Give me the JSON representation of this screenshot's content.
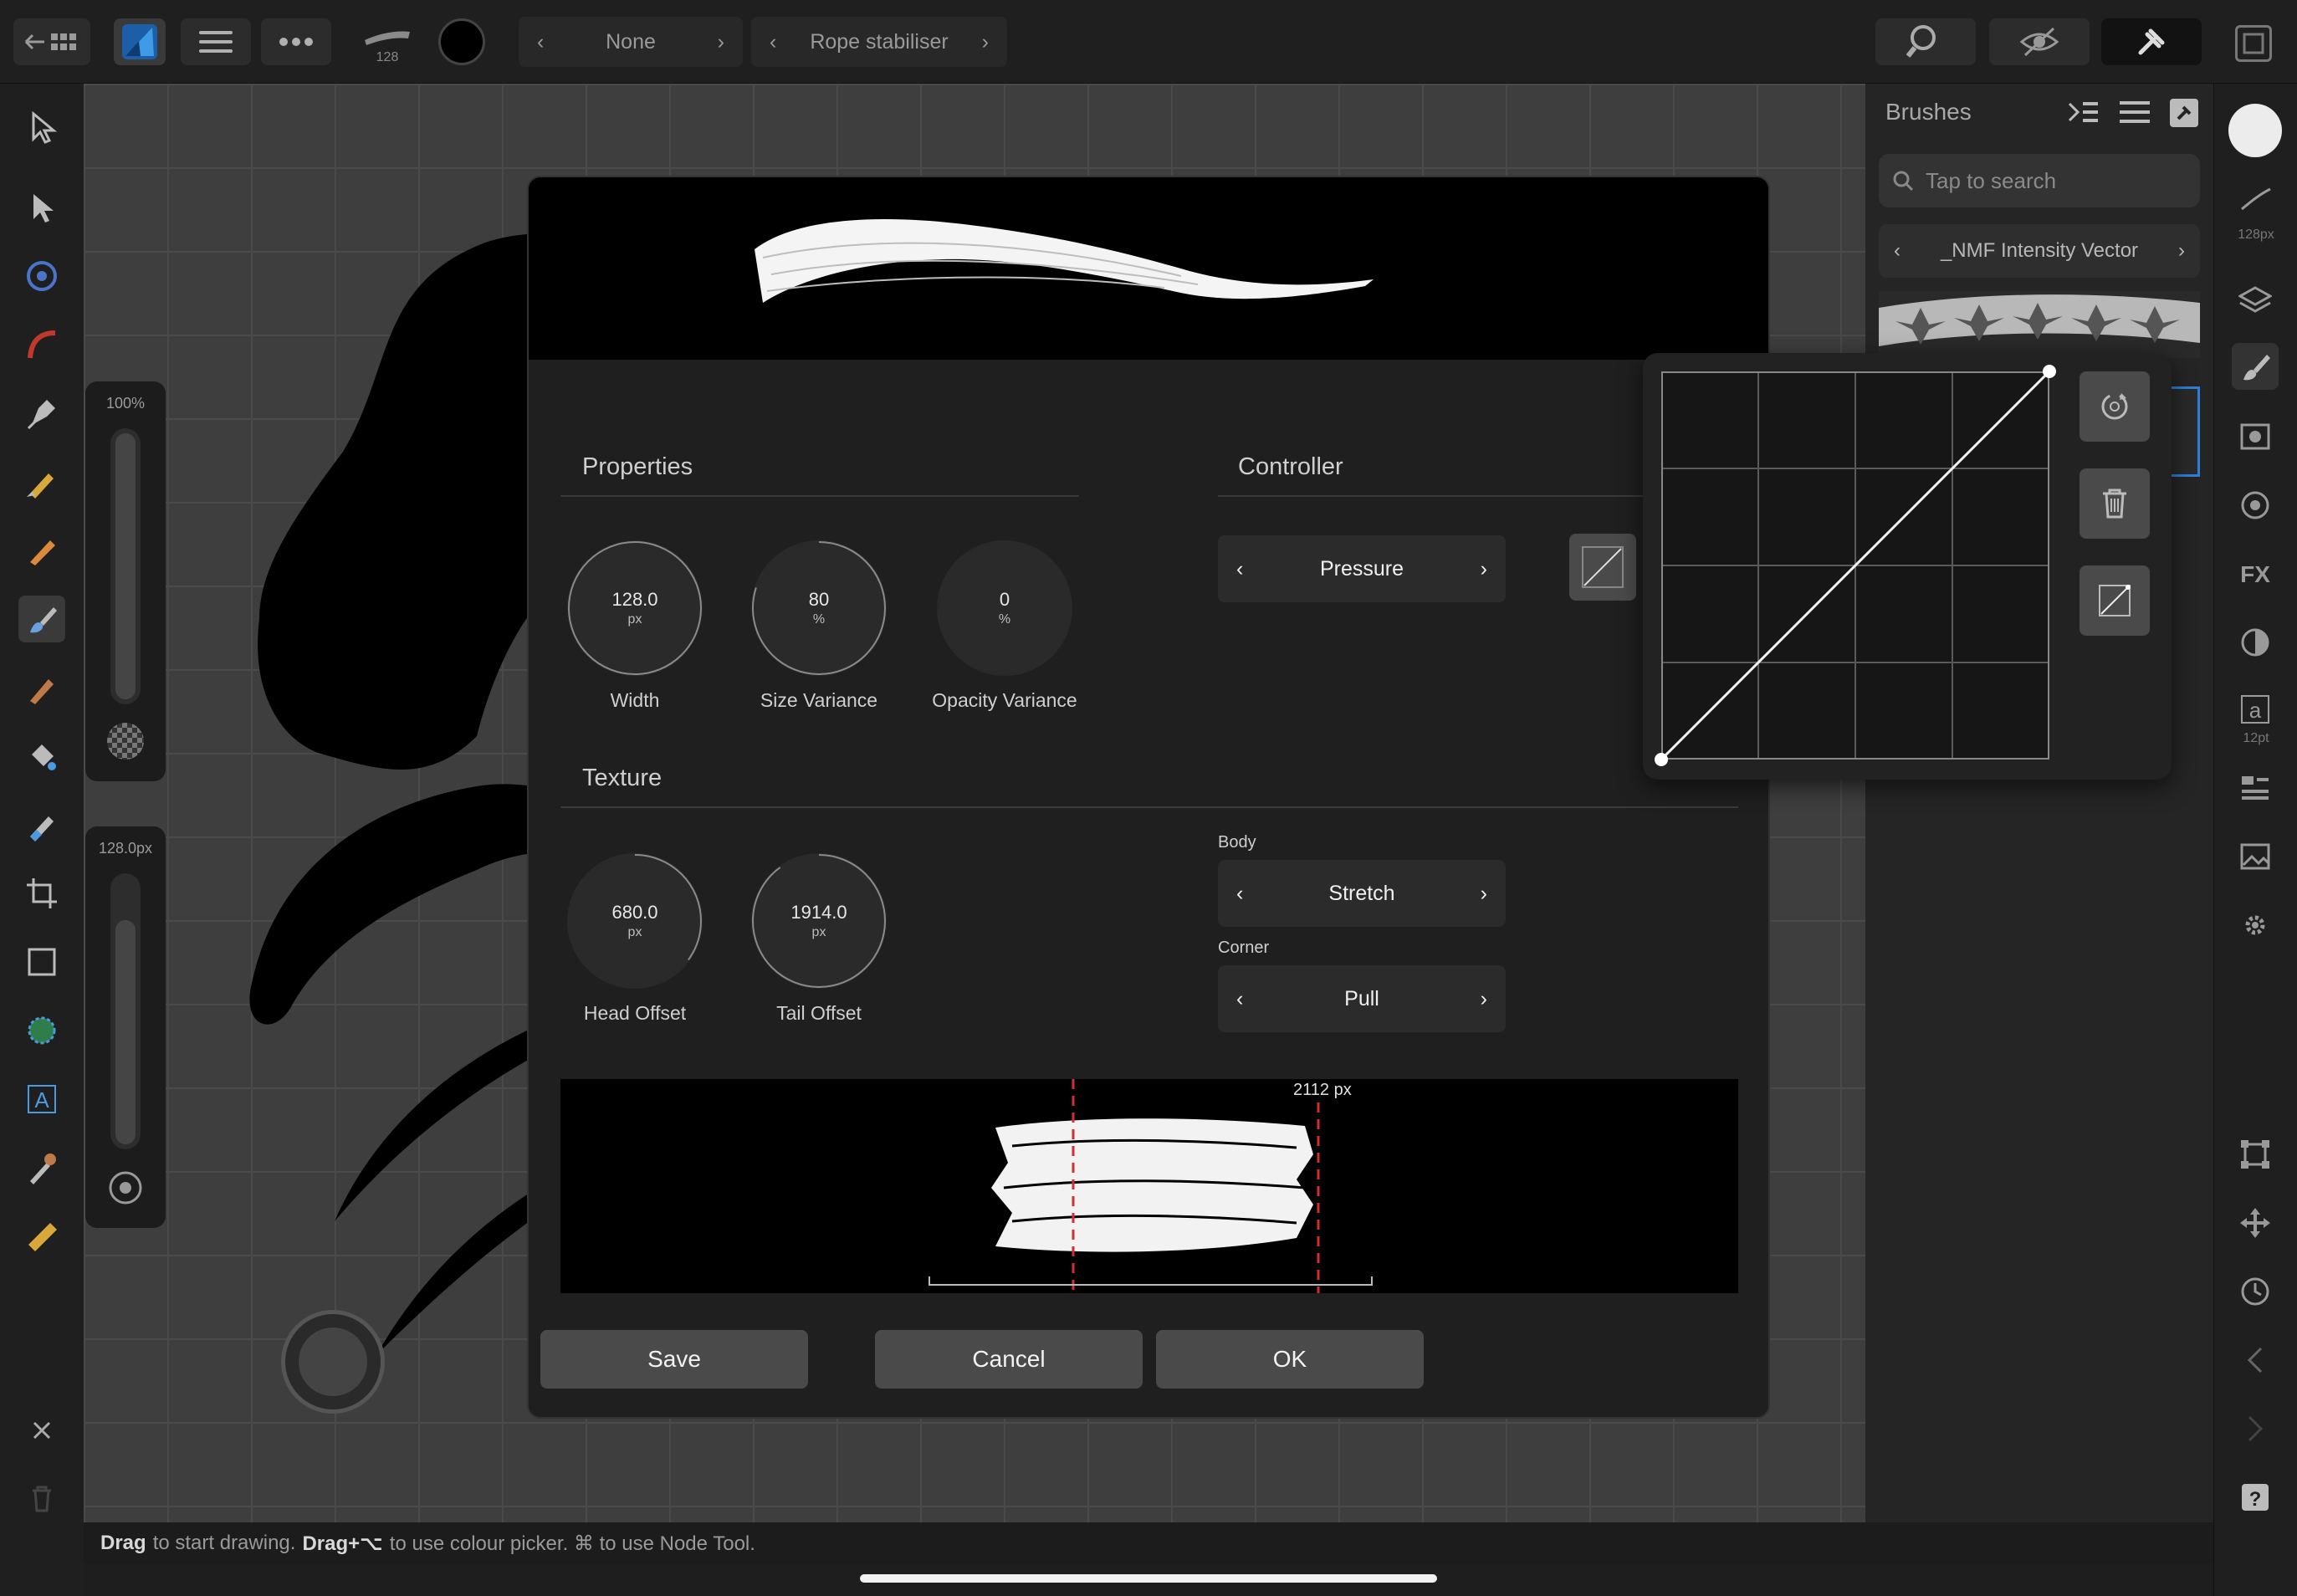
{
  "toolbar": {
    "brush_size_badge": "128",
    "stroke_mode": {
      "value": "None"
    },
    "stabiliser": {
      "value": "Rope stabiliser"
    }
  },
  "left_sliders": {
    "opacity_label": "100%",
    "size_label": "128.0px"
  },
  "brushes_panel": {
    "title": "Brushes",
    "search_placeholder": "Tap to search",
    "category": "_NMF Intensity Vector"
  },
  "right_rail": {
    "size_label": "128px",
    "text_size_label": "12pt"
  },
  "dialog": {
    "properties_title": "Properties",
    "controller_title": "Controller",
    "texture_title": "Texture",
    "properties": [
      {
        "value": "128.0",
        "unit": "px",
        "label": "Width",
        "fraction": 1.0
      },
      {
        "value": "80",
        "unit": "%",
        "label": "Size Variance",
        "fraction": 0.8
      },
      {
        "value": "0",
        "unit": "%",
        "label": "Opacity Variance",
        "fraction": 0.0
      }
    ],
    "controller": {
      "value": "Pressure"
    },
    "texture": [
      {
        "value": "680.0",
        "unit": "px",
        "label": "Head Offset",
        "fraction": 0.35
      },
      {
        "value": "1914.0",
        "unit": "px",
        "label": "Tail Offset",
        "fraction": 0.9
      }
    ],
    "body": {
      "label": "Body",
      "value": "Stretch"
    },
    "corner": {
      "label": "Corner",
      "value": "Pull"
    },
    "preview_measure": "2112 px",
    "buttons": {
      "save": "Save",
      "cancel": "Cancel",
      "ok": "OK"
    }
  },
  "status_bar": {
    "drag1": "Drag",
    "text1": "to start drawing.",
    "drag2": "Drag+⌥",
    "text2": "to use colour picker. ⌘ to use Node Tool."
  }
}
